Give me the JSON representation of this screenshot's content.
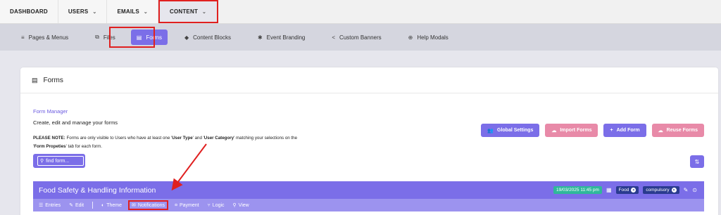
{
  "topnav": {
    "items": [
      {
        "label": "DASHBOARD",
        "chevron": false
      },
      {
        "label": "USERS",
        "chevron": true
      },
      {
        "label": "EMAILS",
        "chevron": true
      },
      {
        "label": "CONTENT",
        "chevron": true
      }
    ],
    "active": "CONTENT"
  },
  "subnav": {
    "items": [
      {
        "label": "Pages & Menus",
        "icon": "menu-icon"
      },
      {
        "label": "Files",
        "icon": "copy-icon"
      },
      {
        "label": "Forms",
        "icon": "document-icon"
      },
      {
        "label": "Content Blocks",
        "icon": "cube-icon"
      },
      {
        "label": "Event Branding",
        "icon": "gear-icon"
      },
      {
        "label": "Custom Banners",
        "icon": "share-icon"
      },
      {
        "label": "Help Modals",
        "icon": "globe-icon"
      }
    ],
    "active": "Forms"
  },
  "card": {
    "header": "Forms",
    "form_manager": "Form Manager",
    "subtitle": "Create, edit and manage your forms",
    "note_prefix": "PLEASE NOTE:",
    "note_1": " Forms are only visible to Users who have at least one '",
    "note_user_type": "User Type",
    "note_2": "' and '",
    "note_user_category": "User Category",
    "note_3": "' matching your selections on the",
    "note_4": "'",
    "note_form_properties": "Form Propeties",
    "note_5": "' tab for each form.",
    "search_placeholder": "find form...",
    "buttons": {
      "global_settings": "Global Settings",
      "import_forms": "Import Forms",
      "add_form": "Add Form",
      "reuse_forms": "Reuse Forms"
    }
  },
  "form_item": {
    "title": "Food Safety & Handling Information",
    "date": "19/03/2025 11:45 pm",
    "tags": [
      "Food",
      "compulsory"
    ],
    "actions": [
      "Entries",
      "Edit",
      "Theme",
      "Notifications",
      "Payment",
      "Logic",
      "View"
    ]
  },
  "colors": {
    "accent": "#7b6ee8",
    "pink": "#e88aa8",
    "highlight": "#e02020",
    "date_badge": "#2fb89a",
    "tag": "#2a3b8f"
  }
}
